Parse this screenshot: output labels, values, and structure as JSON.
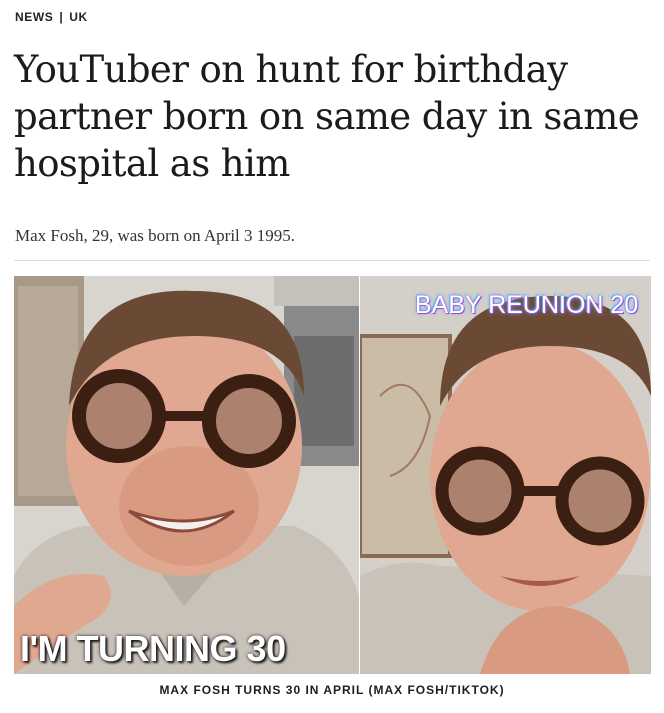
{
  "article": {
    "section": "NEWS",
    "separator": "|",
    "region": "UK",
    "headline": "YouTuber on hunt for birthday partner born on same day in same hospital as him",
    "standfirst": "Max Fosh, 29, was born on April 3 1995."
  },
  "images": {
    "left": {
      "overlay_text": "I'M TURNING 30",
      "subject": "man-with-tortoiseshell-glasses-icon"
    },
    "right": {
      "overlay_text": "BABY REUNION 20",
      "subject": "man-with-tortoiseshell-glasses-icon"
    }
  },
  "caption": "MAX FOSH TURNS 30 IN APRIL (MAX FOSH/TIKTOK)",
  "colors": {
    "text": "#1b1b1b",
    "rule": "#dcdcdc",
    "hoodie": "#c9c2b8",
    "skin": "#e0a890",
    "glasses": "#3a1f12"
  }
}
